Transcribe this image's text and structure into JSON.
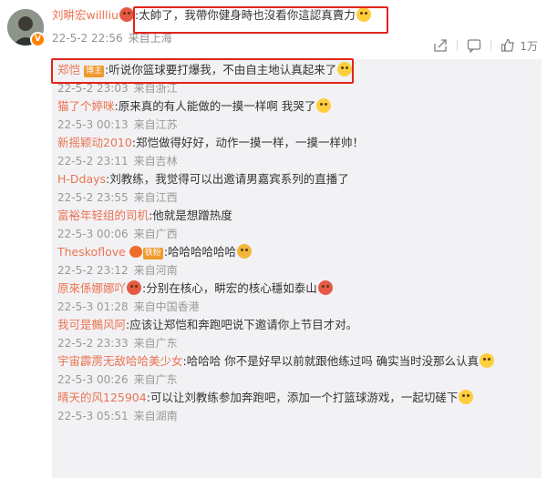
{
  "top_comment": {
    "username": "刘畊宏willliu",
    "text": ":太帥了，我帶你健身時也沒看你這認真賣力",
    "time": "22-5-2 22:56",
    "location": "来自上海",
    "like_count": "1万"
  },
  "icons": [
    "share-icon",
    "comment-icon",
    "like-icon"
  ],
  "replies": [
    {
      "username": "郑恺",
      "badge": "博主",
      "text": ":听说你篮球要打爆我，不由自主地认真起来了",
      "time": "22-5-2 23:03",
      "location": "来自浙江",
      "emoji": "yes"
    },
    {
      "username": "猫了个婷咪",
      "text": ":原来真的有人能做的一摸一样啊 我哭了",
      "time": "22-5-3 00:13",
      "location": "来自江苏",
      "emoji": "yes"
    },
    {
      "username": "新摇颖动2010",
      "text": ":郑恺做得好好，动作一摸一样，一摸一样帅！",
      "time": "22-5-2 23:11",
      "location": "来自吉林"
    },
    {
      "username": "H-Ddays",
      "text": ":刘教练，我觉得可以出邀请男嘉宾系列的直播了",
      "time": "22-5-2 23:55",
      "location": "来自江西"
    },
    {
      "username": "富裕年轻组的司机",
      "text": ":他就是想蹭热度",
      "time": "22-5-3 00:06",
      "location": "来自广西"
    },
    {
      "username": "Theskoflove",
      "badge": "铁粉",
      "text": ":哈哈哈哈哈哈",
      "time": "22-5-2 23:12",
      "location": "来自河南",
      "emoji": "yes"
    },
    {
      "username": "原來係娜娜吖",
      "text": ":分别在核心，畊宏的核心穩如泰山",
      "time": "22-5-3 01:28",
      "location": "来自中国香港",
      "emoji": "yes"
    },
    {
      "username": "我可是鵺风阿",
      "text": ":应该让郑恺和奔跑吧说下邀请你上节目才对。",
      "time": "22-5-2 23:33",
      "location": "来自广东"
    },
    {
      "username": "宇宙霹雳无敌哈哈美少女",
      "text": ":哈哈哈  你不是好早以前就跟他练过吗  确实当时没那么认真",
      "time": "22-5-3 00:26",
      "location": "来自广东",
      "emoji": "yes"
    },
    {
      "username": "晴天的风125904",
      "text": ":可以让刘教练参加奔跑吧，添加一个打篮球游戏，一起切磋下",
      "time": "22-5-3 05:51",
      "location": "来自湖南",
      "emoji": "yes"
    }
  ]
}
